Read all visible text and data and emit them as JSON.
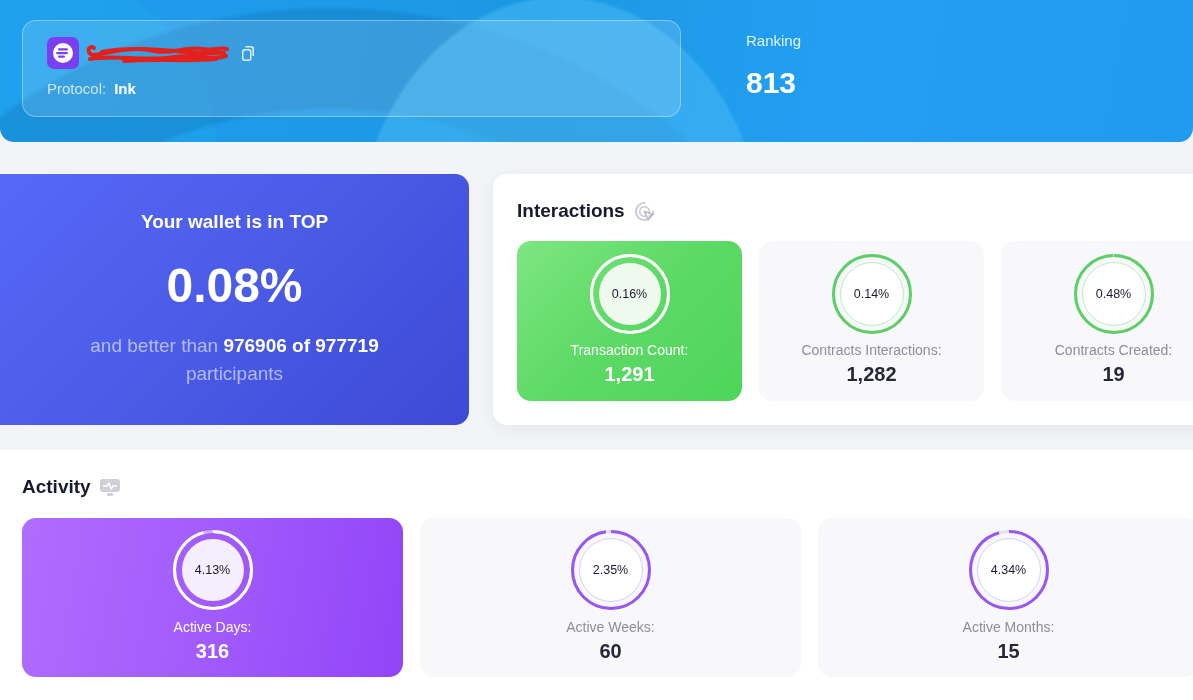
{
  "header": {
    "address": {
      "redacted": true
    },
    "protocol_label": "Protocol:",
    "protocol": "Ink",
    "ranking_label": "Ranking",
    "ranking": "813"
  },
  "top_card": {
    "title": "Your wallet is in TOP",
    "percent": "0.08%",
    "summary": "and better than **976906 of 977719** participants"
  },
  "interactions": {
    "title": "Interactions",
    "items": [
      {
        "label": "Transaction Count:",
        "value": "1,291",
        "percent": "0.16%",
        "level": 0.998,
        "highlighted": true
      },
      {
        "label": "Contracts Interactions:",
        "value": "1,282",
        "percent": "0.14%",
        "level": 0.999,
        "highlighted": false
      },
      {
        "label": "Contracts Created:",
        "value": "19",
        "percent": "0.48%",
        "level": 0.995,
        "highlighted": false
      }
    ]
  },
  "activity": {
    "title": "Activity",
    "items": [
      {
        "label": "Active Days:",
        "value": "316",
        "percent": "4.13%",
        "level": 0.959,
        "highlighted": true
      },
      {
        "label": "Active Weeks:",
        "value": "60",
        "percent": "2.35%",
        "level": 0.977,
        "highlighted": false
      },
      {
        "label": "Active Months:",
        "value": "15",
        "percent": "4.34%",
        "level": 0.957,
        "highlighted": false
      }
    ]
  }
}
